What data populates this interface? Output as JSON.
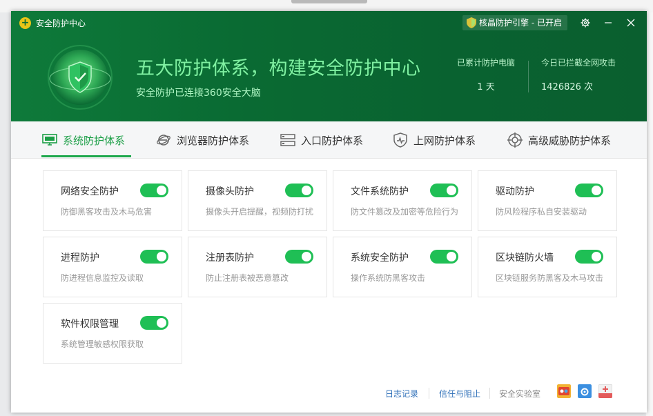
{
  "window": {
    "app_title": "安全防护中心",
    "engine_badge": "核晶防护引擎 - 已开启"
  },
  "header": {
    "headline": "五大防护体系，构建安全防护中心",
    "subline": "安全防护已连接360安全大脑",
    "stats": [
      {
        "label": "已累计防护电脑",
        "value": "1 天"
      },
      {
        "label": "今日已拦截全网攻击",
        "value": "1426826 次"
      }
    ]
  },
  "tabs": [
    {
      "label": "系统防护体系",
      "icon": "monitor-icon",
      "active": true
    },
    {
      "label": "浏览器防护体系",
      "icon": "browser-icon",
      "active": false
    },
    {
      "label": "入口防护体系",
      "icon": "entry-icon",
      "active": false
    },
    {
      "label": "上网防护体系",
      "icon": "shield-icon",
      "active": false
    },
    {
      "label": "高级威胁防护体系",
      "icon": "threat-icon",
      "active": false
    }
  ],
  "cards": [
    {
      "title": "网络安全防护",
      "desc": "防御黑客攻击及木马危害",
      "enabled": true
    },
    {
      "title": "摄像头防护",
      "desc": "摄像头开启提醒，视频防打扰",
      "enabled": true
    },
    {
      "title": "文件系统防护",
      "desc": "防文件篡改及加密等危险行为",
      "enabled": true
    },
    {
      "title": "驱动防护",
      "desc": "防风险程序私自安装驱动",
      "enabled": true
    },
    {
      "title": "进程防护",
      "desc": "防进程信息监控及读取",
      "enabled": true
    },
    {
      "title": "注册表防护",
      "desc": "防止注册表被恶意篡改",
      "enabled": true
    },
    {
      "title": "系统安全防护",
      "desc": "操作系统防黑客攻击",
      "enabled": true
    },
    {
      "title": "区块链防火墙",
      "desc": "区块链服务防黑客及木马攻击",
      "enabled": true
    },
    {
      "title": "软件权限管理",
      "desc": "系统管理敏感权限获取",
      "enabled": true
    }
  ],
  "footer": {
    "log_link": "日志记录",
    "trust_link": "信任与阻止",
    "lab_text": "安全实验室"
  },
  "colors": {
    "header_green": "#0a6b33",
    "accent_green": "#1fbf55",
    "headline_green": "#7ff0a1",
    "link_blue": "#2e6fb8"
  }
}
